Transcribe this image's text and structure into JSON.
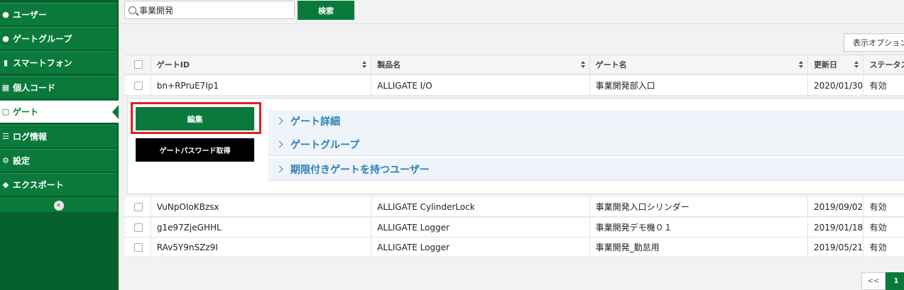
{
  "sidebar": {
    "items": [
      {
        "label": "ユーザー",
        "icon": "user-icon"
      },
      {
        "label": "ゲートグループ",
        "icon": "group-icon"
      },
      {
        "label": "スマートフォン",
        "icon": "smartphone-icon"
      },
      {
        "label": "個人コード",
        "icon": "keypad-icon"
      },
      {
        "label": "ゲート",
        "icon": "gate-icon",
        "active": true
      },
      {
        "label": "ログ情報",
        "icon": "list-icon"
      },
      {
        "label": "設定",
        "icon": "gear-icon"
      },
      {
        "label": "エクスポート",
        "icon": "export-icon"
      }
    ],
    "collapse_label": "«"
  },
  "search": {
    "value": "事業開発",
    "button_label": "検索"
  },
  "display_options_label": "表示オプション",
  "table": {
    "headers": [
      "ゲートID",
      "製品名",
      "ゲート名",
      "更新日",
      "ステータス"
    ],
    "rows": [
      {
        "id": "bn+RPruE7Ip1",
        "product": "ALLIGATE I/O",
        "name": "事業開発部入口",
        "date": "2020/01/30",
        "status": "有効"
      },
      {
        "id": "VuNpOIoKBzsx",
        "product": "ALLIGATE CylinderLock",
        "name": "事業開発入口シリンダー",
        "date": "2019/09/02",
        "status": "有効"
      },
      {
        "id": "g1e97ZjeGHHL",
        "product": "ALLIGATE Logger",
        "name": "事業開発デモ機０１",
        "date": "2019/01/18",
        "status": "有効"
      },
      {
        "id": "RAv5Y9nSZz9I",
        "product": "ALLIGATE Logger",
        "name": "事業開発_勤怠用",
        "date": "2019/05/21",
        "status": "有効"
      }
    ]
  },
  "detail": {
    "edit_label": "編集",
    "password_label": "ゲートパスワード取得",
    "sections": [
      "ゲート詳細",
      "ゲートグループ",
      "期限付きゲートを持つユーザー"
    ]
  },
  "pagination": {
    "prev_label": "<<",
    "current": "1"
  },
  "colors": {
    "brand_green": "#0a7a3b",
    "highlight_red": "#e02020",
    "accordion_text": "#2c7fb8"
  }
}
